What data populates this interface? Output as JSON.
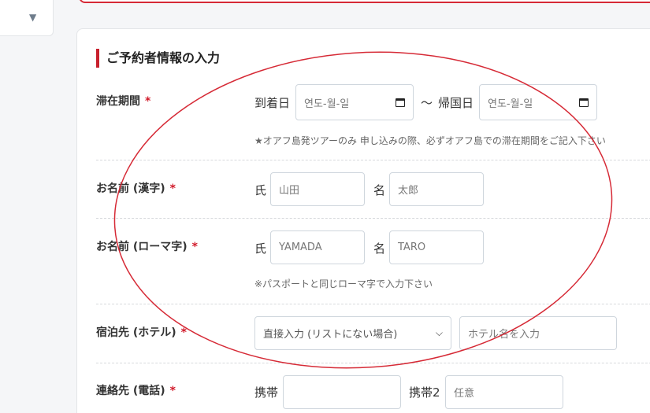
{
  "left_widget": {
    "icon": "caret-down-icon",
    "glyph": "▼"
  },
  "section": {
    "title": "ご予約者情報の入力"
  },
  "required_mark": "*",
  "stay": {
    "label": "滞在期間",
    "arrival_label": "到着日",
    "arrival_placeholder": "연도-월-일",
    "tilde": "～",
    "return_label": "帰国日",
    "return_placeholder": "연도-월-일",
    "note": "★オアフ島発ツアーのみ 申し込みの際、必ずオアフ島での滞在期間をご記入下さい"
  },
  "name_kanji": {
    "label": "お名前 (漢字)",
    "last_label": "氏",
    "last_placeholder": "山田",
    "first_label": "名",
    "first_placeholder": "太郎"
  },
  "name_roman": {
    "label": "お名前 (ローマ字)",
    "last_label": "氏",
    "last_placeholder": "YAMADA",
    "first_label": "名",
    "first_placeholder": "TARO",
    "note": "※パスポートと同じローマ字で入力下さい"
  },
  "hotel": {
    "label": "宿泊先 (ホテル)",
    "select_value": "直接入力 (リストにない場合)",
    "input_placeholder": "ホテル名を入力"
  },
  "contact": {
    "label": "連絡先 (電話)",
    "mobile_label": "携帯",
    "mobile_value": "",
    "mobile2_label": "携帯2",
    "mobile2_placeholder": "任意"
  },
  "colors": {
    "accent": "#c8202d",
    "annotation": "#d62a36"
  }
}
